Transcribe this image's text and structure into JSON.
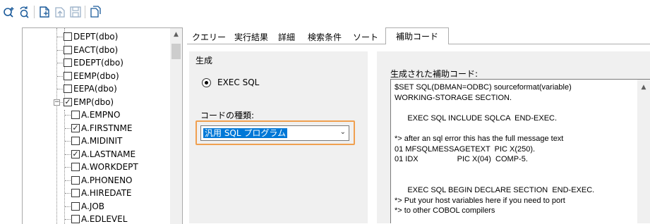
{
  "toolbar": {
    "icons": [
      "add-query-icon",
      "refresh-query-icon",
      "new-document-icon",
      "open-document-icon",
      "save-icon",
      "copy-icon"
    ]
  },
  "tree": {
    "items": [
      {
        "label": "DEPT(dbo)",
        "checked": false
      },
      {
        "label": "EACT(dbo)",
        "checked": false
      },
      {
        "label": "EDEPT(dbo)",
        "checked": false
      },
      {
        "label": "EEMP(dbo)",
        "checked": false
      },
      {
        "label": "EEPA(dbo)",
        "checked": false
      },
      {
        "label": "EMP(dbo)",
        "checked": true,
        "expanded": true
      },
      {
        "label": "A.EMPNO",
        "checked": false
      },
      {
        "label": "A.FIRSTNME",
        "checked": true
      },
      {
        "label": "A.MIDINIT",
        "checked": false
      },
      {
        "label": "A.LASTNAME",
        "checked": true
      },
      {
        "label": "A.WORKDEPT",
        "checked": false
      },
      {
        "label": "A.PHONENO",
        "checked": false
      },
      {
        "label": "A.HIREDATE",
        "checked": false
      },
      {
        "label": "A.JOB",
        "checked": false
      },
      {
        "label": "A.EDLEVEL",
        "checked": false
      }
    ],
    "expander_minus": "−",
    "scroll_up": "▲"
  },
  "tabs": [
    {
      "label": "クエリー",
      "active": false
    },
    {
      "label": "実行結果",
      "active": false
    },
    {
      "label": "詳細",
      "active": false
    },
    {
      "label": "検索条件",
      "active": false
    },
    {
      "label": "ソート",
      "active": false
    },
    {
      "label": "補助コード",
      "active": true
    }
  ],
  "generate": {
    "title": "生成",
    "radio_label": "EXEC SQL",
    "code_type_label": "コードの種類:",
    "code_type_value": "汎用 SQL プログラム",
    "dropdown_chevron": "⌄"
  },
  "generated": {
    "title": "生成された補助コード:",
    "lines": [
      "$SET SQL(DBMAN=ODBC) sourceformat(variable)",
      "WORKING-STORAGE SECTION.",
      "",
      "      EXEC SQL INCLUDE SQLCA  END-EXEC.",
      "",
      "*> after an sql error this has the full message text",
      "01 MFSQLMESSAGETEXT  PIC X(250).",
      "01 IDX                  PIC X(04)  COMP-5.",
      "",
      "",
      "      EXEC SQL BEGIN DECLARE SECTION  END-EXEC.",
      "*> Put your host variables here if you need to port",
      "*> to other COBOL compilers"
    ],
    "scroll_up": "▲"
  }
}
